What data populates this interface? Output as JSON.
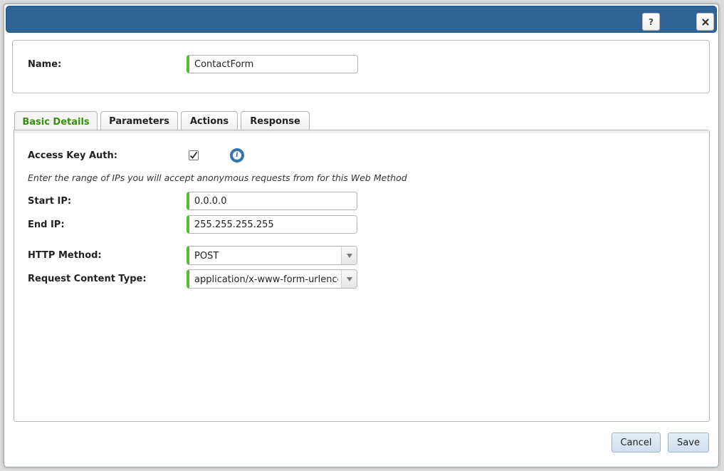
{
  "titlebar": {
    "help_icon": "question-mark-icon",
    "close_icon": "close-x-icon",
    "help_label": "?"
  },
  "name_section": {
    "label": "Name:",
    "value": "ContactForm"
  },
  "tabs": [
    {
      "label": "Basic Details",
      "active": true
    },
    {
      "label": "Parameters",
      "active": false
    },
    {
      "label": "Actions",
      "active": false
    },
    {
      "label": "Response",
      "active": false
    }
  ],
  "basic_details": {
    "access_key_auth": {
      "label": "Access Key Auth:",
      "checked": true,
      "info_icon": "info-icon"
    },
    "ip_hint": "Enter the range of IPs you will accept anonymous requests from for this Web Method",
    "start_ip": {
      "label": "Start IP:",
      "value": "0.0.0.0"
    },
    "end_ip": {
      "label": "End IP:",
      "value": "255.255.255.255"
    },
    "http_method": {
      "label": "HTTP Method:",
      "value": "POST"
    },
    "request_content_type": {
      "label": "Request Content Type:",
      "value": "application/x-www-form-urlencoded"
    }
  },
  "footer": {
    "cancel_label": "Cancel",
    "save_label": "Save"
  },
  "colors": {
    "titlebar": "#2f6295",
    "field_accent": "#4fbe2f",
    "active_tab_text": "#3b8d13",
    "info_icon": "#3674ac"
  }
}
